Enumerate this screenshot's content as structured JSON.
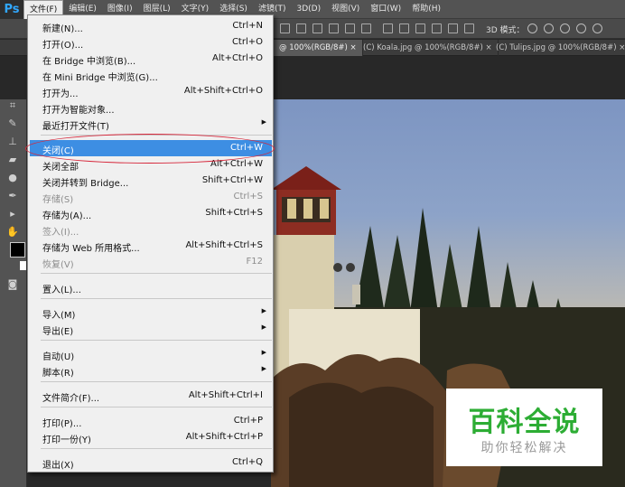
{
  "app": {
    "logo": "Ps"
  },
  "menubar": {
    "items": [
      {
        "label": "文件(F)",
        "active": true
      },
      {
        "label": "编辑(E)"
      },
      {
        "label": "图像(I)"
      },
      {
        "label": "图层(L)"
      },
      {
        "label": "文字(Y)"
      },
      {
        "label": "选择(S)"
      },
      {
        "label": "滤镜(T)"
      },
      {
        "label": "3D(D)"
      },
      {
        "label": "视图(V)"
      },
      {
        "label": "窗口(W)"
      },
      {
        "label": "帮助(H)"
      }
    ]
  },
  "options_bar": {
    "mode_label": "3D 模式："
  },
  "tabs": [
    {
      "label": "@ 100%(RGB/8#) ×",
      "active": true
    },
    {
      "label": "(C) Koala.jpg @ 100%(RGB/8#) ×"
    },
    {
      "label": "(C) Tulips.jpg @ 100%(RGB/8#) ×"
    }
  ],
  "file_menu": {
    "items": [
      {
        "label": "新建(N)...",
        "shortcut": "Ctrl+N"
      },
      {
        "label": "打开(O)...",
        "shortcut": "Ctrl+O"
      },
      {
        "label": "在 Bridge 中浏览(B)...",
        "shortcut": "Alt+Ctrl+O"
      },
      {
        "label": "在 Mini Bridge 中浏览(G)...",
        "shortcut": ""
      },
      {
        "label": "打开为...",
        "shortcut": "Alt+Shift+Ctrl+O"
      },
      {
        "label": "打开为智能对象...",
        "shortcut": ""
      },
      {
        "label": "最近打开文件(T)",
        "shortcut": "",
        "submenu": true
      },
      {
        "label": "关闭(C)",
        "shortcut": "Ctrl+W",
        "highlighted": true
      },
      {
        "label": "关闭全部",
        "shortcut": "Alt+Ctrl+W"
      },
      {
        "label": "关闭并转到 Bridge...",
        "shortcut": "Shift+Ctrl+W"
      },
      {
        "label": "存储(S)",
        "shortcut": "Ctrl+S",
        "disabled": true
      },
      {
        "label": "存储为(A)...",
        "shortcut": "Shift+Ctrl+S"
      },
      {
        "label": "签入(I)...",
        "shortcut": "",
        "disabled": true
      },
      {
        "label": "存储为 Web 所用格式...",
        "shortcut": "Alt+Shift+Ctrl+S"
      },
      {
        "label": "恢复(V)",
        "shortcut": "F12",
        "disabled": true
      },
      {
        "label": "置入(L)...",
        "shortcut": ""
      },
      {
        "label": "导入(M)",
        "shortcut": "",
        "submenu": true
      },
      {
        "label": "导出(E)",
        "shortcut": "",
        "submenu": true
      },
      {
        "label": "自动(U)",
        "shortcut": "",
        "submenu": true
      },
      {
        "label": "脚本(R)",
        "shortcut": "",
        "submenu": true
      },
      {
        "label": "文件简介(F)...",
        "shortcut": "Alt+Shift+Ctrl+I"
      },
      {
        "label": "打印(P)...",
        "shortcut": "Ctrl+P"
      },
      {
        "label": "打印一份(Y)",
        "shortcut": "Alt+Shift+Ctrl+P"
      },
      {
        "label": "退出(X)",
        "shortcut": "Ctrl+Q"
      }
    ],
    "submenu_arrow": "▶"
  },
  "watermark": {
    "title": "百科全说",
    "subtitle": "助你轻松解决"
  },
  "colors": {
    "highlight": "#3d8ee3",
    "ring": "#d6263a",
    "watermark_green": "#2dad34",
    "foreground_swatch": "#000000",
    "background_swatch": "#ffffff"
  }
}
